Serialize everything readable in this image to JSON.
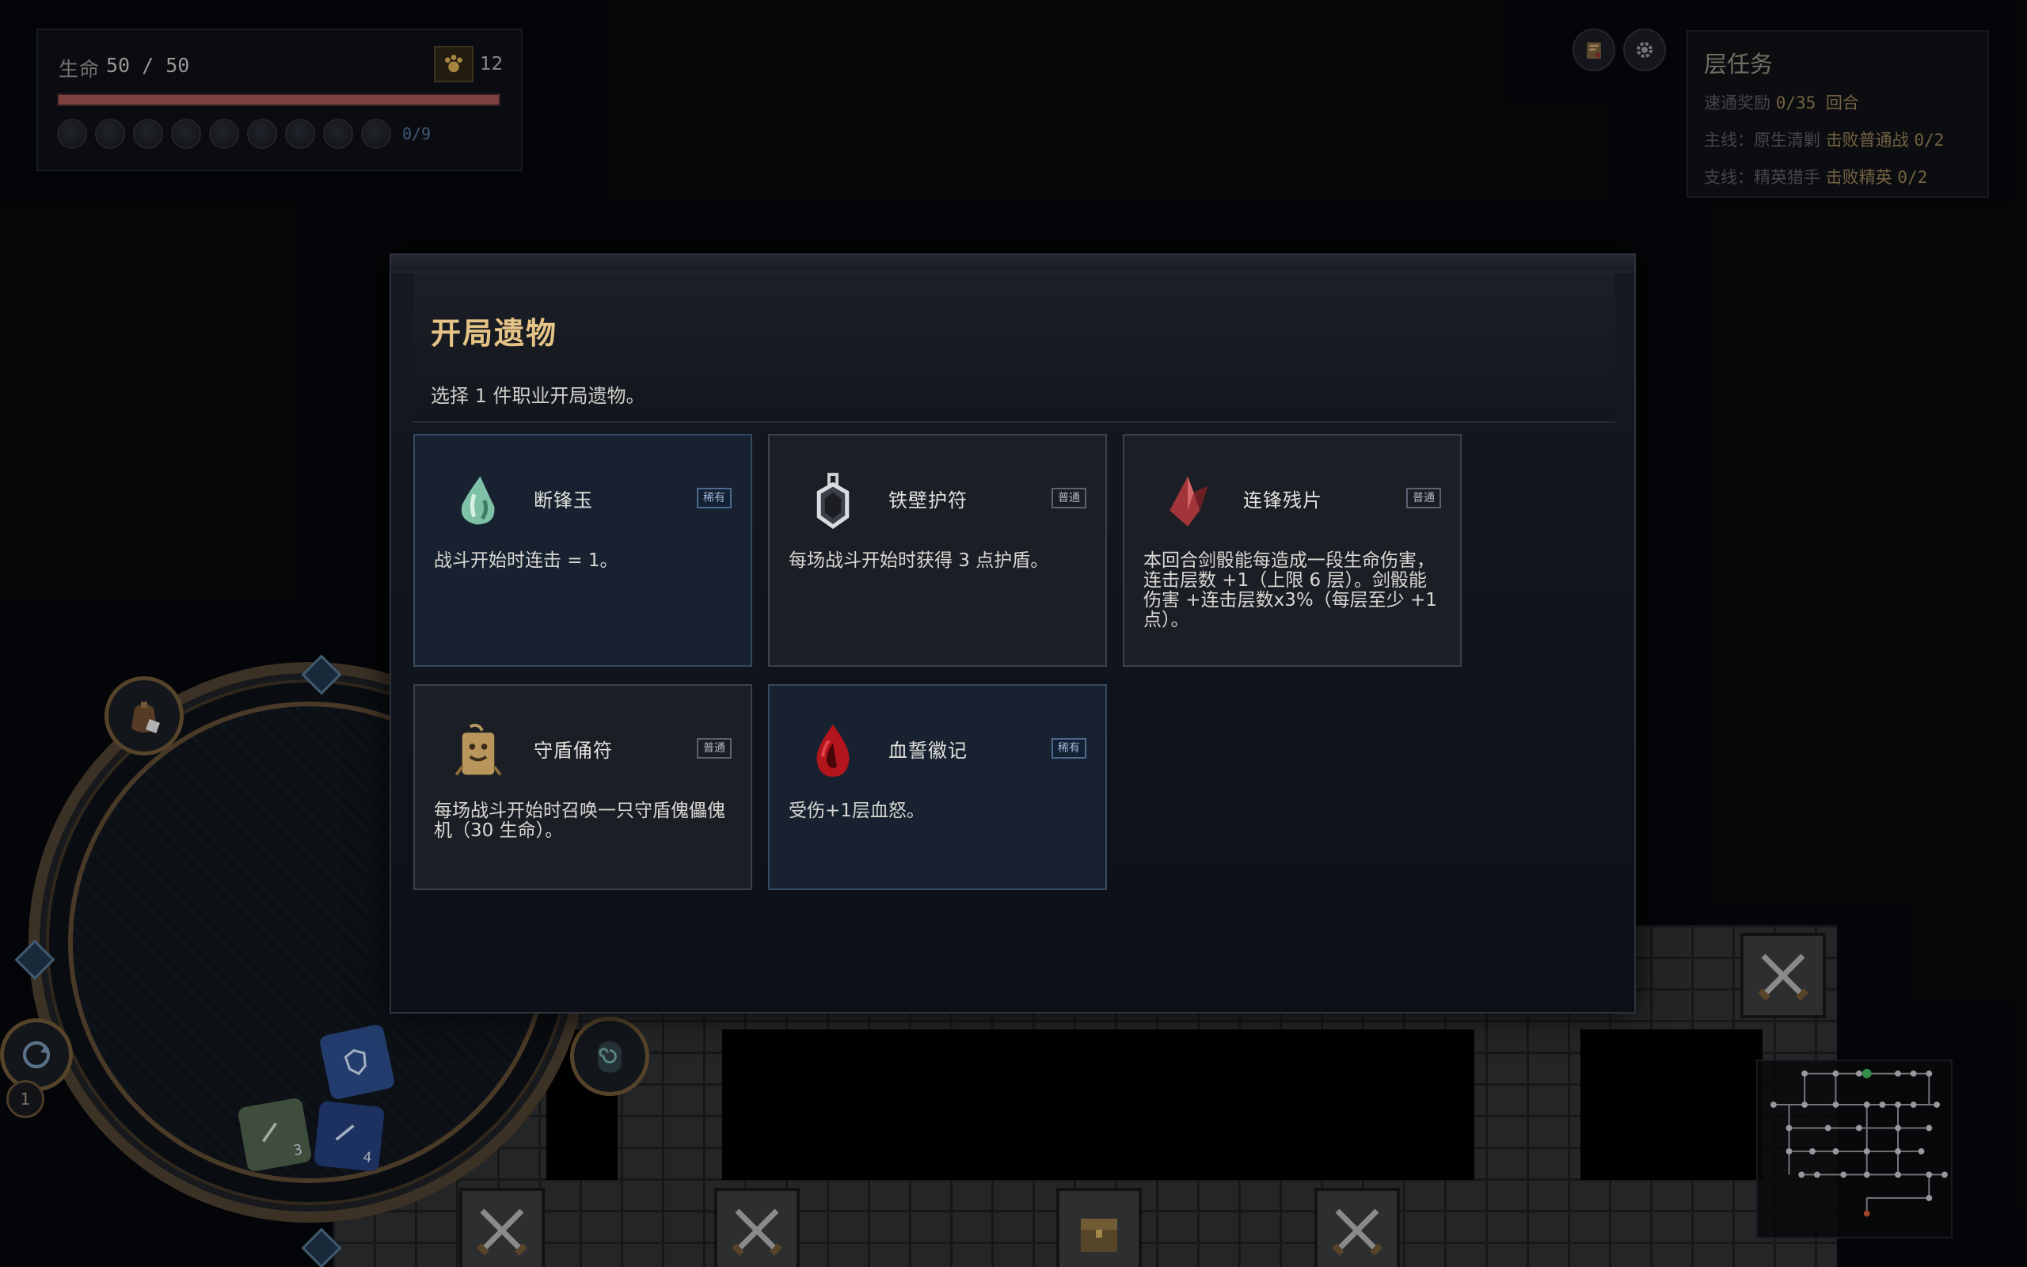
{
  "status": {
    "hp_label": "生命",
    "hp_value": "50 / 50",
    "hp_fraction": 1.0,
    "gold_icon": "paw-coin-icon",
    "gold_count": "12",
    "orb_slots": 9,
    "orb_count": "0/9"
  },
  "topbar": {
    "map_button_icon": "scroll-map-icon",
    "settings_button_icon": "gear-icon"
  },
  "quest": {
    "title": "层任务",
    "speed_label": "速通奖励",
    "speed_value": "0/35 回合",
    "main_label": "主线：",
    "main_name": "原生清剿",
    "main_goal": "击败普通战",
    "main_count": "0/2",
    "side_label": "支线：",
    "side_name": "精英猎手",
    "side_goal": "击败精英",
    "side_count": "0/2"
  },
  "dice_tray": {
    "turn_count": "1",
    "dice": [
      {
        "face": "sword",
        "value": "3",
        "color": "#4d5f4b"
      },
      {
        "face": "sword",
        "value": "4",
        "color": "#233c76"
      },
      {
        "face": "shield-heart",
        "value": "",
        "color": "#2a4b86"
      }
    ]
  },
  "modal": {
    "title": "开局遗物",
    "subtitle": "选择 1 件职业开局遗物。",
    "cards": [
      {
        "name": "断锋玉",
        "tag": "稀有",
        "rarity": "rare",
        "icon": "jade-drop-icon",
        "desc": "战斗开始时连击 = 1。"
      },
      {
        "name": "铁壁护符",
        "tag": "普通",
        "rarity": "common",
        "icon": "iron-amulet-icon",
        "desc": "每场战斗开始时获得 3 点护盾。"
      },
      {
        "name": "连锋残片",
        "tag": "普通",
        "rarity": "common",
        "icon": "red-crystal-shard-icon",
        "desc": "本回合剑骰能每造成一段生命伤害，连击层数 +1（上限 6 层）。剑骰能伤害 +连击层数x3%（每层至少 +1 点）。"
      },
      {
        "name": "守盾俑符",
        "tag": "普通",
        "rarity": "common",
        "icon": "puppet-talisman-icon",
        "desc": "每场战斗开始时召唤一只守盾傀儡傀机（30 生命）。"
      },
      {
        "name": "血誓徽记",
        "tag": "稀有",
        "rarity": "rare",
        "icon": "blood-drop-icon",
        "desc": "受伤+1层血怒。"
      }
    ]
  },
  "colors": {
    "accent_gold": "#e6c487",
    "rare_blue": "#17212f",
    "hp_red": "#9c4f4f"
  }
}
